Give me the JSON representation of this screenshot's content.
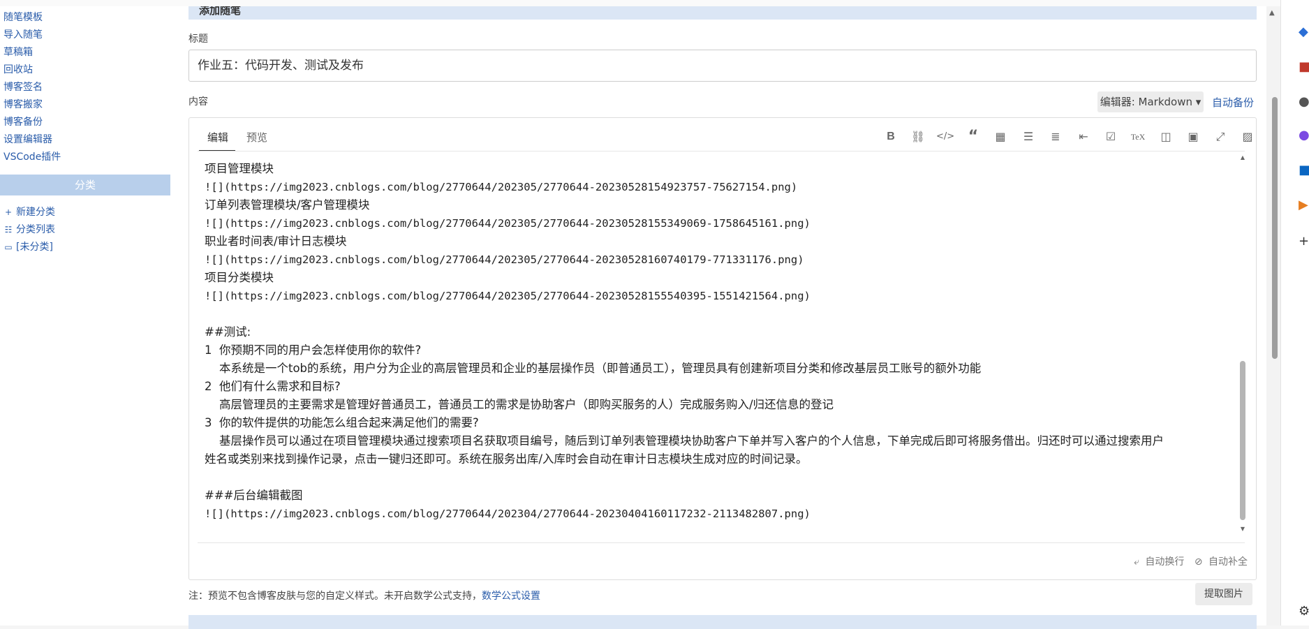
{
  "sidebar": {
    "links": [
      "随笔模板",
      "导入随笔",
      "草稿箱",
      "回收站",
      "博客签名",
      "博客搬家",
      "博客备份",
      "设置编辑器",
      "VSCode插件"
    ],
    "category_header": "分类",
    "category_links": [
      {
        "icon": "plus-icon",
        "glyph": "+",
        "label": "新建分类"
      },
      {
        "icon": "list-icon",
        "glyph": "☷",
        "label": "分类列表"
      },
      {
        "icon": "folder-icon",
        "glyph": "▭",
        "label": "[未分类]"
      }
    ]
  },
  "main": {
    "section_title": "添加随笔",
    "title_label": "标题",
    "title_value": "作业五：代码开发、测试及发布",
    "content_label": "内容",
    "editor_select": "编辑器: Markdown ▾",
    "auto_backup": "自动备份",
    "tabs": [
      "编辑",
      "预览"
    ],
    "toolbar_icons": [
      "bold-icon",
      "link-icon",
      "code-icon",
      "quote-icon",
      "table-icon",
      "unordered-list-icon",
      "ordered-list-icon",
      "outdent-icon",
      "checkbox-icon",
      "tex-icon",
      "columns-icon",
      "save-icon",
      "fullscreen-icon",
      "image-icon"
    ],
    "editor_lines": [
      "项目管理模块",
      "![](https://img2023.cnblogs.com/blog/2770644/202305/2770644-20230528154923757-75627154.png)",
      "订单列表管理模块/客户管理模块",
      "![](https://img2023.cnblogs.com/blog/2770644/202305/2770644-20230528155349069-1758645161.png)",
      "职业者时间表/审计日志模块",
      "![](https://img2023.cnblogs.com/blog/2770644/202305/2770644-20230528160740179-771331176.png)",
      "项目分类模块",
      "![](https://img2023.cnblogs.com/blog/2770644/202305/2770644-20230528155540395-1551421564.png)",
      "",
      "##测试:",
      "1  你预期不同的用户会怎样使用你的软件?",
      "    本系统是一个tob的系统，用户分为企业的高层管理员和企业的基层操作员（即普通员工），管理员具有创建新项目分类和修改基层员工账号的额外功能",
      "2  他们有什么需求和目标?",
      "    高层管理员的主要需求是管理好普通员工，普通员工的需求是协助客户（即购买服务的人）完成服务购入/归还信息的登记",
      "3  你的软件提供的功能怎么组合起来满足他们的需要?",
      "    基层操作员可以通过在项目管理模块通过搜索项目名获取项目编号，随后到订单列表管理模块协助客户下单并写入客户的个人信息，下单完成后即可将服务借出。归还时可以通过搜索用户",
      "姓名或类别来找到操作记录，点击一键归还即可。系统在服务出库/入库时会自动在审计日志模块生成对应的时间记录。",
      "",
      "###后台编辑截图",
      "![](https://img2023.cnblogs.com/blog/2770644/202304/2770644-20230404160117232-2113482807.png)"
    ],
    "footer_wrap": "自动换行",
    "footer_complete": "自动补全",
    "note_text": "注：预览不包含博客皮肤与您的自定义样式。未开启数学公式支持，",
    "note_link": "数学公式设置",
    "fetch_button": "提取图片"
  }
}
